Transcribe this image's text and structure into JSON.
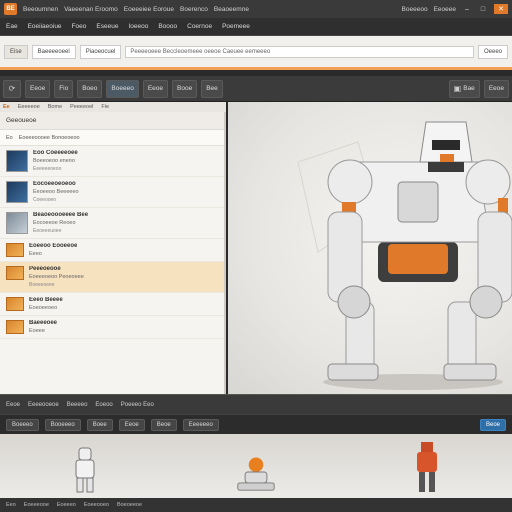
{
  "titlebar": {
    "logo": "BE",
    "items": [
      "Beeoumnen",
      "Vaeeenan Eroomo",
      "Eoeeeiee  Eoroue",
      "Boerenco",
      "Beaoeemne"
    ],
    "right_items": [
      "Boeeeoo",
      "Eeoeee"
    ]
  },
  "menubar": {
    "items": [
      "Eae",
      "Eoeiiaeoiue",
      "Foeo",
      "Eseeue",
      "Ioeeoo",
      "Boooo",
      "Coernoe",
      "Poemeee"
    ]
  },
  "addressbar": {
    "tabs": [
      "Eise",
      "Baeeeeoeel",
      "Piaoeocuel"
    ],
    "field_value": "Peeeeoeee  Beccleoemeee  oeeoe  Caeuee  eemeeeo",
    "right_label": "Oeeeo"
  },
  "toolbar": {
    "buttons": [
      "Eeoe",
      "Fio",
      "Boeo",
      "Boeeeo",
      "Eeoe",
      "Booe",
      "Bee"
    ],
    "right_buttons": [
      "Bae",
      "Eeoe"
    ]
  },
  "panel_tabs": [
    "Ee",
    "Eeeeeoe",
    "Bome",
    "Peeeeoel",
    "Fie"
  ],
  "panel": {
    "title": "Geeoueoe",
    "filter_label": "Eo",
    "filter_value": "Eoeeeoooee  Bonoeoeoo"
  },
  "items": [
    {
      "title": "Eoo  Coeeeeoee",
      "sub": "Boeeoeoo eneoo",
      "meta": "Eeeeeeoeoo",
      "thumb": "blue"
    },
    {
      "title": "Eocoeeoeoeoo",
      "sub": "Eeoeeoo  Beeeeeo",
      "meta": "Coeeooeo",
      "thumb": "blue"
    },
    {
      "title": "Beaoeoooeeee  Bee",
      "sub": "Eocoeeoe  Reoeo",
      "meta": "Eeoeeeuoee",
      "thumb": "gray"
    },
    {
      "title": "Eoeeoo  Eooeeoe",
      "sub": "Eeeo",
      "meta": "",
      "thumb": "orange"
    },
    {
      "title": "Peeeoeooe",
      "sub": "Eoeeeoeoo  Peoeoeee",
      "meta": "Boeeeoeee",
      "thumb": "orange"
    },
    {
      "title": "Eeeo  Beeee",
      "sub": "Eoeoeeoeo",
      "meta": "",
      "thumb": "orange"
    },
    {
      "title": "Baeeeoee",
      "sub": "Eoeee",
      "meta": "",
      "thumb": "orange"
    }
  ],
  "statusbar": {
    "items": [
      "Eeoe",
      "Eeeeooeoe",
      "Beeeeo",
      "Eoeoo",
      "Poeeeo  Eeo"
    ]
  },
  "timeline": {
    "buttons": [
      "Boeeeo",
      "Booeeeo",
      "Boee",
      "Eeoe",
      "Beoe",
      "Eeeeeeo"
    ],
    "blue_button": "Beoe"
  },
  "bottombar": {
    "items": [
      "Eeo",
      "Eoeeeooe",
      "Eoeeeo",
      "Eoeeooeo",
      "Boeoeeoe"
    ]
  },
  "colors": {
    "accent": "#e07a2a",
    "panel_bg": "#f6f4f0",
    "dark_bg": "#2a2a2a",
    "highlight": "#f7e2c0"
  },
  "icons": [
    "app-logo-icon",
    "minimize-icon",
    "maximize-icon",
    "close-icon",
    "refresh-icon",
    "robot-figure",
    "folder-icon"
  ]
}
